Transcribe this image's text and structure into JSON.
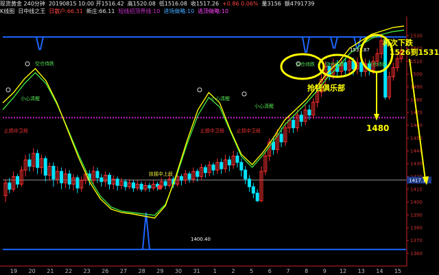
{
  "header": {
    "line1": [
      "现货黄金 240分钟",
      "20190815 10:00 开1516.42",
      "高1520.08",
      "低1516.08",
      "收1517.26",
      "+0.86 0.06%",
      "量3156",
      "额4791739"
    ],
    "line2": [
      {
        "text": "K线图",
        "color": "#e0e0e0"
      },
      {
        "text": "日中线之王",
        "color": "#e0e0e0"
      },
      {
        "text": "日散户:66.31",
        "color": "#ff4444"
      },
      {
        "text": "新庄:66.11",
        "color": "#e0e0e0"
      },
      {
        "text": "短线招顶界线:10",
        "color": "#cc33cc"
      },
      {
        "text": "进场做略:10",
        "color": "#44aaff"
      },
      {
        "text": "逃顶做略:10",
        "color": "#ff44ff"
      }
    ]
  },
  "annotations": {
    "club": "抢钱俱乐部",
    "drop_line1": "再次下跌",
    "drop_line2": "1526到1531",
    "low_1480": "1480",
    "low_1400": "1400.40",
    "high_1531": "1531.87",
    "current_price": "1417.17",
    "kongcang": "空仓待跌",
    "xiaoxin": "小心清醒",
    "zhiying": "止损中卫段",
    "fuyun": "扶摇中上段"
  },
  "colors": {
    "up": "#ff3030",
    "down": "#00e5ff",
    "line_yellow": "#ffff00",
    "line_green": "#40e040",
    "blue": "#1e66ff",
    "magenta": "#d020d0",
    "axis": "#cc2222",
    "annotation": "#ffff00"
  },
  "chart_data": {
    "type": "candlestick",
    "ylim": [
      1350,
      1545
    ],
    "y_ticks": [
      1530,
      1520,
      1510,
      1500,
      1490,
      1480,
      1470,
      1460,
      1450,
      1440,
      1430,
      1420,
      1410,
      1400,
      1390,
      1380,
      1370,
      1360
    ],
    "date_labels": [
      "19",
      "20",
      "21",
      "22",
      "23",
      "26",
      "27",
      "28",
      "29",
      "30",
      "31",
      "1",
      "2",
      "5",
      "6",
      "7",
      "8",
      "9",
      "12",
      "13",
      "14",
      "15"
    ],
    "blue_top_level": 1529,
    "magenta_level": 1466,
    "last_price": 1417.17,
    "marked_low": 1400.4,
    "marked_high": 1531.87,
    "marked_drop_low": 1480,
    "candles": [
      [
        1405,
        1415,
        1400,
        1418
      ],
      [
        1415,
        1410,
        1407,
        1419
      ],
      [
        1410,
        1420,
        1408,
        1424
      ],
      [
        1420,
        1414,
        1411,
        1422
      ],
      [
        1414,
        1425,
        1412,
        1428
      ],
      [
        1425,
        1433,
        1420,
        1437
      ],
      [
        1433,
        1428,
        1424,
        1438
      ],
      [
        1428,
        1438,
        1424,
        1442
      ],
      [
        1438,
        1427,
        1422,
        1441
      ],
      [
        1427,
        1434,
        1422,
        1437
      ],
      [
        1434,
        1421,
        1416,
        1436
      ],
      [
        1421,
        1428,
        1417,
        1431
      ],
      [
        1428,
        1418,
        1412,
        1431
      ],
      [
        1418,
        1424,
        1414,
        1428
      ],
      [
        1424,
        1415,
        1410,
        1427
      ],
      [
        1415,
        1422,
        1411,
        1426
      ],
      [
        1422,
        1414,
        1410,
        1425
      ],
      [
        1414,
        1419,
        1409,
        1422
      ],
      [
        1419,
        1411,
        1407,
        1421
      ],
      [
        1411,
        1417,
        1408,
        1420
      ],
      [
        1417,
        1422,
        1414,
        1426
      ],
      [
        1422,
        1417,
        1413,
        1425
      ],
      [
        1417,
        1424,
        1414,
        1428
      ],
      [
        1424,
        1419,
        1415,
        1427
      ],
      [
        1419,
        1416,
        1412,
        1422
      ],
      [
        1416,
        1421,
        1412,
        1424
      ],
      [
        1421,
        1414,
        1410,
        1423
      ],
      [
        1414,
        1418,
        1410,
        1421
      ],
      [
        1418,
        1413,
        1409,
        1420
      ],
      [
        1413,
        1416,
        1410,
        1419
      ],
      [
        1416,
        1412,
        1409,
        1418
      ],
      [
        1412,
        1415,
        1410,
        1418
      ],
      [
        1415,
        1411,
        1408,
        1417
      ],
      [
        1411,
        1414,
        1409,
        1417
      ],
      [
        1414,
        1410,
        1408,
        1416
      ],
      [
        1410,
        1413,
        1408,
        1416
      ],
      [
        1413,
        1411,
        1408,
        1415
      ],
      [
        1411,
        1414,
        1409,
        1417
      ],
      [
        1414,
        1412,
        1409,
        1416
      ],
      [
        1412,
        1416,
        1410,
        1419
      ],
      [
        1416,
        1413,
        1410,
        1418
      ],
      [
        1413,
        1418,
        1411,
        1421
      ],
      [
        1418,
        1414,
        1411,
        1420
      ],
      [
        1414,
        1420,
        1412,
        1423
      ],
      [
        1420,
        1417,
        1413,
        1422
      ],
      [
        1417,
        1422,
        1414,
        1425
      ],
      [
        1422,
        1418,
        1415,
        1424
      ],
      [
        1418,
        1424,
        1415,
        1427
      ],
      [
        1424,
        1420,
        1416,
        1426
      ],
      [
        1420,
        1427,
        1417,
        1430
      ],
      [
        1427,
        1423,
        1419,
        1429
      ],
      [
        1423,
        1429,
        1420,
        1432
      ],
      [
        1429,
        1425,
        1421,
        1431
      ],
      [
        1425,
        1431,
        1422,
        1434
      ],
      [
        1431,
        1426,
        1422,
        1434
      ],
      [
        1426,
        1433,
        1423,
        1437
      ],
      [
        1433,
        1429,
        1424,
        1436
      ],
      [
        1429,
        1436,
        1426,
        1440
      ],
      [
        1436,
        1431,
        1427,
        1439
      ],
      [
        1431,
        1425,
        1420,
        1434
      ],
      [
        1425,
        1418,
        1414,
        1428
      ],
      [
        1418,
        1412,
        1408,
        1421
      ],
      [
        1412,
        1407,
        1403,
        1415
      ],
      [
        1407,
        1401,
        1400,
        1410
      ],
      [
        1401,
        1424,
        1400,
        1428
      ],
      [
        1424,
        1436,
        1421,
        1440
      ],
      [
        1436,
        1447,
        1432,
        1450
      ],
      [
        1447,
        1441,
        1437,
        1451
      ],
      [
        1441,
        1453,
        1438,
        1457
      ],
      [
        1453,
        1447,
        1443,
        1458
      ],
      [
        1447,
        1458,
        1444,
        1462
      ],
      [
        1458,
        1464,
        1454,
        1468
      ],
      [
        1464,
        1458,
        1454,
        1468
      ],
      [
        1458,
        1468,
        1455,
        1472
      ],
      [
        1468,
        1463,
        1459,
        1471
      ],
      [
        1463,
        1472,
        1460,
        1476
      ],
      [
        1472,
        1468,
        1464,
        1476
      ],
      [
        1468,
        1478,
        1465,
        1481
      ],
      [
        1478,
        1486,
        1474,
        1490
      ],
      [
        1486,
        1496,
        1482,
        1500
      ],
      [
        1496,
        1506,
        1492,
        1510
      ],
      [
        1506,
        1500,
        1495,
        1509
      ],
      [
        1500,
        1508,
        1496,
        1512
      ],
      [
        1508,
        1502,
        1497,
        1511
      ],
      [
        1502,
        1509,
        1498,
        1513
      ],
      [
        1509,
        1503,
        1498,
        1512
      ],
      [
        1503,
        1510,
        1499,
        1514
      ],
      [
        1510,
        1504,
        1499,
        1513
      ],
      [
        1504,
        1509,
        1500,
        1513
      ],
      [
        1509,
        1502,
        1498,
        1512
      ],
      [
        1502,
        1508,
        1498,
        1512
      ],
      [
        1508,
        1503,
        1499,
        1511
      ],
      [
        1503,
        1510,
        1500,
        1514
      ],
      [
        1510,
        1516,
        1506,
        1520
      ],
      [
        1516,
        1526,
        1512,
        1531.87
      ],
      [
        1526,
        1482,
        1480,
        1528
      ],
      [
        1482,
        1498,
        1480,
        1502
      ],
      [
        1498,
        1505,
        1495,
        1509
      ],
      [
        1505,
        1512,
        1502,
        1516
      ],
      [
        1512,
        1518,
        1509,
        1521
      ]
    ]
  }
}
